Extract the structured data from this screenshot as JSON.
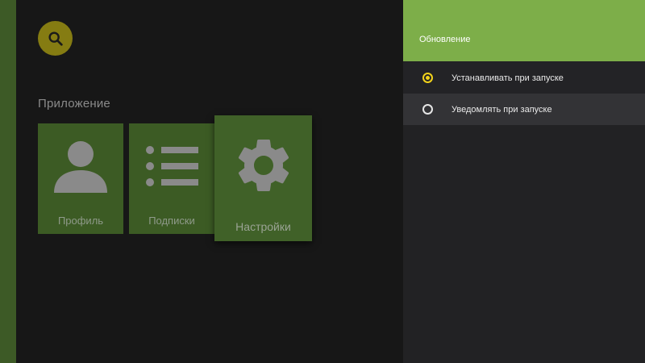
{
  "app": {
    "section_title": "Приложение",
    "search_icon": "search-icon"
  },
  "cards": [
    {
      "label": "Профиль",
      "icon": "person-icon"
    },
    {
      "label": "Подписки",
      "icon": "list-icon"
    },
    {
      "label": "Настройки",
      "icon": "gear-icon",
      "focused": true
    }
  ],
  "panel": {
    "title": "Обновление",
    "options": [
      {
        "label": "Устанавливать при запуске",
        "selected": true
      },
      {
        "label": "Уведомлять при запуске",
        "selected": false
      }
    ]
  },
  "colors": {
    "accent": "#7dae49",
    "card": "#3c5b24",
    "radio_selected": "#f2d21b",
    "search_button": "#857c12"
  }
}
